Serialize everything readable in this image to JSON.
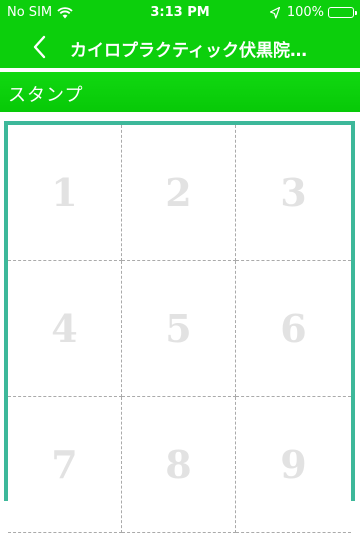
{
  "status_bar": {
    "carrier": "No SIM",
    "time": "3:13 PM",
    "battery": "100%"
  },
  "nav": {
    "title": "カイロプラクティック伏黒院…"
  },
  "section": {
    "title": "スタンプ"
  },
  "stamps": {
    "cells": [
      "1",
      "2",
      "3",
      "4",
      "5",
      "6",
      "7",
      "8",
      "9"
    ]
  },
  "colors": {
    "header_green": "#0ccf0c",
    "card_border": "#3db89a",
    "stamp_number": "#e2e2e2"
  }
}
